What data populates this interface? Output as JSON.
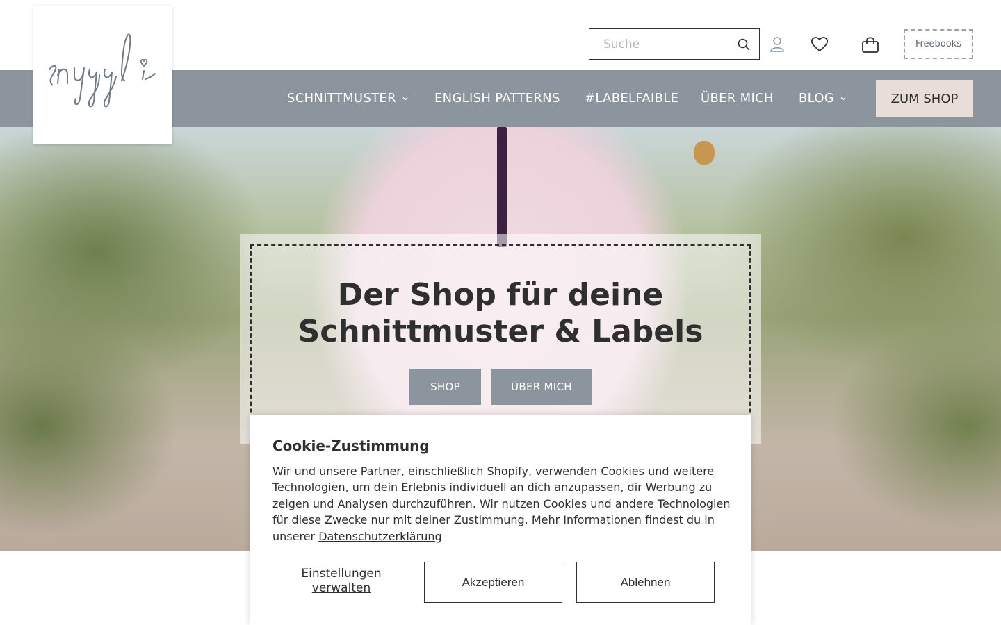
{
  "brand": {
    "logo_text": "snyggli"
  },
  "header": {
    "search": {
      "placeholder": "Suche"
    },
    "freebooks_label": "Freebooks"
  },
  "nav": {
    "items": [
      {
        "label": "SCHNITTMUSTER",
        "has_dropdown": true
      },
      {
        "label": "ENGLISH PATTERNS",
        "has_dropdown": false
      },
      {
        "label": "#LABELFAIBLE",
        "has_dropdown": false
      },
      {
        "label": "ÜBER MICH",
        "has_dropdown": false
      },
      {
        "label": "BLOG",
        "has_dropdown": true
      }
    ],
    "cta_label": "ZUM SHOP"
  },
  "hero": {
    "title_line1": "Der Shop für deine",
    "title_line2": "Schnittmuster & Labels",
    "buttons": {
      "shop": "SHOP",
      "about": "ÜBER MICH"
    }
  },
  "cookie": {
    "title": "Cookie-Zustimmung",
    "text": "Wir und unsere Partner, einschließlich Shopify, verwenden Cookies und weitere Technologien, um dein Erlebnis individuell an dich anzupassen, dir Werbung zu zeigen und Analysen durchzuführen. Wir nutzen Cookies und andere Technologien für diese Zwecke nur mit deiner Zustimmung. Mehr Informationen findest du in unserer",
    "link_label": "Datenschutzerklärung",
    "settings_label": "Einstellungen verwalten",
    "accept_label": "Akzeptieren",
    "decline_label": "Ablehnen"
  },
  "colors": {
    "nav_bg": "#8c959e",
    "cta_bg": "#e8ddd7",
    "text": "#2f2f2f"
  },
  "icons": [
    "search-icon",
    "account-icon",
    "heart-icon",
    "cart-icon",
    "chevron-down-icon"
  ]
}
